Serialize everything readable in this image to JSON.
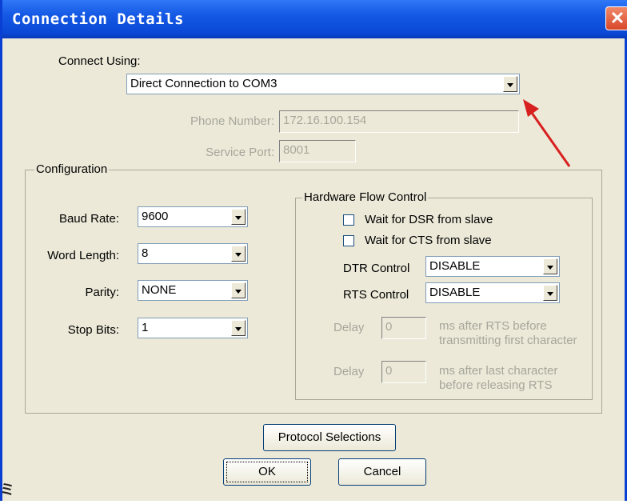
{
  "window": {
    "title": "Connection Details",
    "close_glyph": "✕"
  },
  "connect": {
    "label": "Connect Using:",
    "value": "Direct Connection to COM3"
  },
  "phone": {
    "label": "Phone Number:",
    "value": "172.16.100.154"
  },
  "service": {
    "label": "Service Port:",
    "value": "8001"
  },
  "config": {
    "legend": "Configuration",
    "baud": {
      "label": "Baud Rate:",
      "value": "9600"
    },
    "word": {
      "label": "Word Length:",
      "value": "8"
    },
    "parity": {
      "label": "Parity:",
      "value": "NONE"
    },
    "stop": {
      "label": "Stop Bits:",
      "value": "1"
    }
  },
  "hw": {
    "legend": "Hardware Flow Control",
    "dsr": "Wait for DSR from slave",
    "cts": "Wait for CTS from slave",
    "dtr": {
      "label": "DTR Control",
      "value": "DISABLE"
    },
    "rts": {
      "label": "RTS Control",
      "value": "DISABLE"
    },
    "delay1": {
      "label": "Delay",
      "value": "0",
      "desc1": "ms after RTS before",
      "desc2": "transmitting first character"
    },
    "delay2": {
      "label": "Delay",
      "value": "0",
      "desc1": "ms after last character",
      "desc2": "before releasing RTS"
    }
  },
  "buttons": {
    "protocol": "Protocol Selections",
    "ok": "OK",
    "cancel": "Cancel"
  },
  "residue_glyph": "ミ",
  "colors": {
    "title_bar": "#0a49d6",
    "arrow": "#d82020",
    "dialog_bg": "#ece9d8"
  }
}
